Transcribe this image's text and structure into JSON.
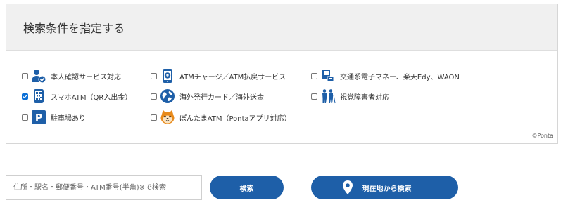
{
  "header": {
    "title": "検索条件を指定する"
  },
  "options": [
    {
      "label": "本人確認サービス対応",
      "icon": "id-verification-icon",
      "checked": false
    },
    {
      "label": "ATMチャージ／ATM払戻サービス",
      "icon": "smartphone-atm-charge-icon",
      "checked": false
    },
    {
      "label": "交通系電子マネー、楽天Edy、WAON",
      "icon": "ic-card-reader-icon",
      "checked": false
    },
    {
      "label": "スマホATM（QR入出金）",
      "icon": "smartphone-qr-icon",
      "checked": true
    },
    {
      "label": "海外発行カード／海外送金",
      "icon": "globe-icon",
      "checked": false
    },
    {
      "label": "視覚障害者対応",
      "icon": "visually-impaired-icon",
      "checked": false
    },
    {
      "label": "駐車場あり",
      "icon": "parking-icon",
      "checked": false
    },
    {
      "label": "ぽんたまATM（Pontaアプリ対応）",
      "icon": "ponta-character-icon",
      "checked": false
    }
  ],
  "credit": "©Ponta",
  "search": {
    "placeholder": "住所・駅名・郵便番号・ATM番号(半角)※で検索"
  },
  "buttons": {
    "search_label": "検索",
    "location_label": "現在地から検索"
  },
  "colors": {
    "accent": "#1e5fa8",
    "header_bg": "#f0f0f0",
    "checkbox_checked": "#0b6fd6"
  }
}
